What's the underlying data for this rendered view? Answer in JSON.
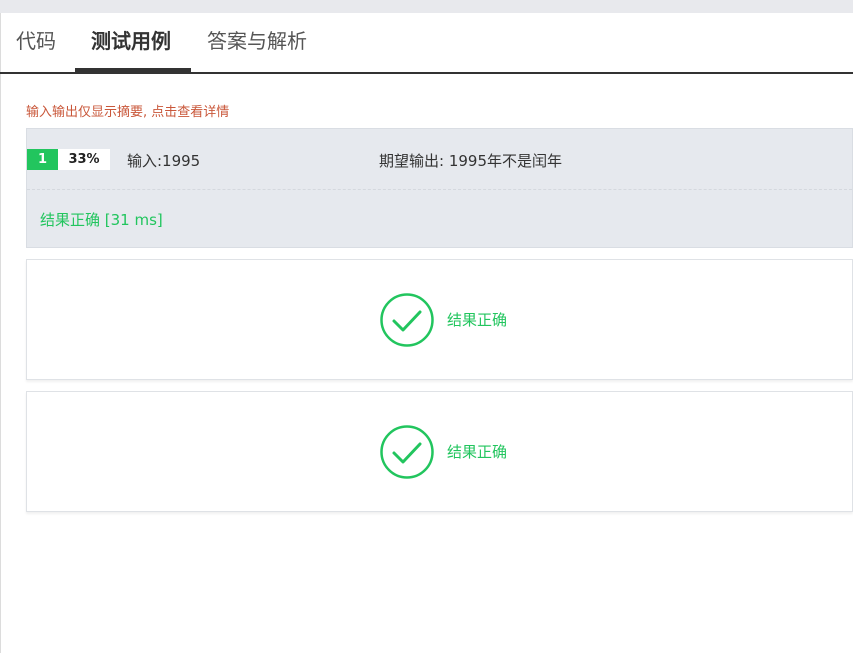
{
  "tabs": [
    {
      "label": "代码"
    },
    {
      "label": "测试用例"
    },
    {
      "label": "答案与解析"
    }
  ],
  "notice": "输入输出仅显示摘要, 点击查看详情",
  "test_case": {
    "index": "1",
    "percent": "33%",
    "input": "输入:1995",
    "expected": "期望输出: 1995年不是闰年",
    "result": "结果正确 [31 ms]"
  },
  "result_cards": [
    {
      "label": "结果正确",
      "icon": "check-circle-icon"
    },
    {
      "label": "结果正确",
      "icon": "check-circle-icon"
    }
  ],
  "colors": {
    "success": "#22c55e",
    "notice": "#c9573a",
    "case_bg": "#e6e9ee"
  }
}
